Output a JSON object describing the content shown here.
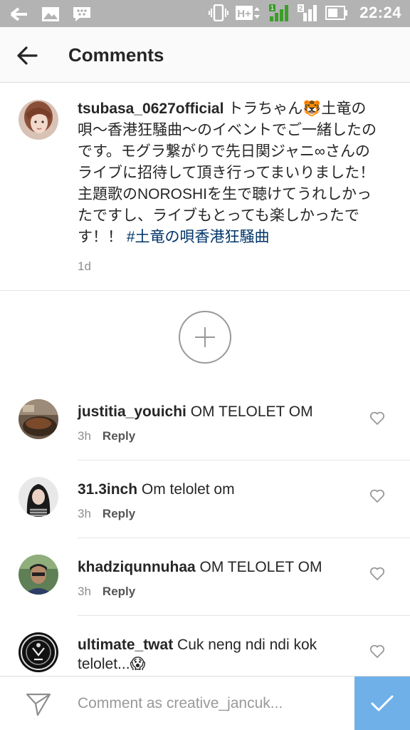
{
  "status_bar": {
    "time": "22:24",
    "network_type": "H+",
    "sim_number": "2"
  },
  "header": {
    "title": "Comments",
    "back_icon": "arrow-left-icon"
  },
  "caption": {
    "username": "tsubasa_0627official",
    "text": " トラちゃん🐯土竜の唄〜香港狂騒曲〜のイベントでご一緒したのです。モグラ繋がりで先日関ジャニ∞さんのライブに招待して頂き行ってまいりました！主題歌のNOROSHIを生で聴けてうれしかったですし、ライブもとっても楽しかったです！！ ",
    "hashtag": "#土竜の唄香港狂騒曲",
    "time": "1d"
  },
  "load_more": {
    "icon": "plus-circle-icon"
  },
  "comments": [
    {
      "username": "justitia_youichi",
      "text": " OM TELOLET OM",
      "time": "3h",
      "reply_label": "Reply"
    },
    {
      "username": "31.3inch",
      "text": " Om telolet om",
      "time": "3h",
      "reply_label": "Reply"
    },
    {
      "username": "khadziqunnuhaa",
      "text": " OM TELOLET OM",
      "time": "3h",
      "reply_label": "Reply"
    },
    {
      "username": "ultimate_twat",
      "text": " Cuk neng ndi ndi kok telolet...😱",
      "time": "",
      "reply_label": ""
    }
  ],
  "composer": {
    "placeholder": "Comment as creative_jancuk...",
    "value": ""
  },
  "colors": {
    "hashtag": "#003569",
    "post_button": "#70b0e8",
    "status_bar": "#b3b3b3"
  }
}
